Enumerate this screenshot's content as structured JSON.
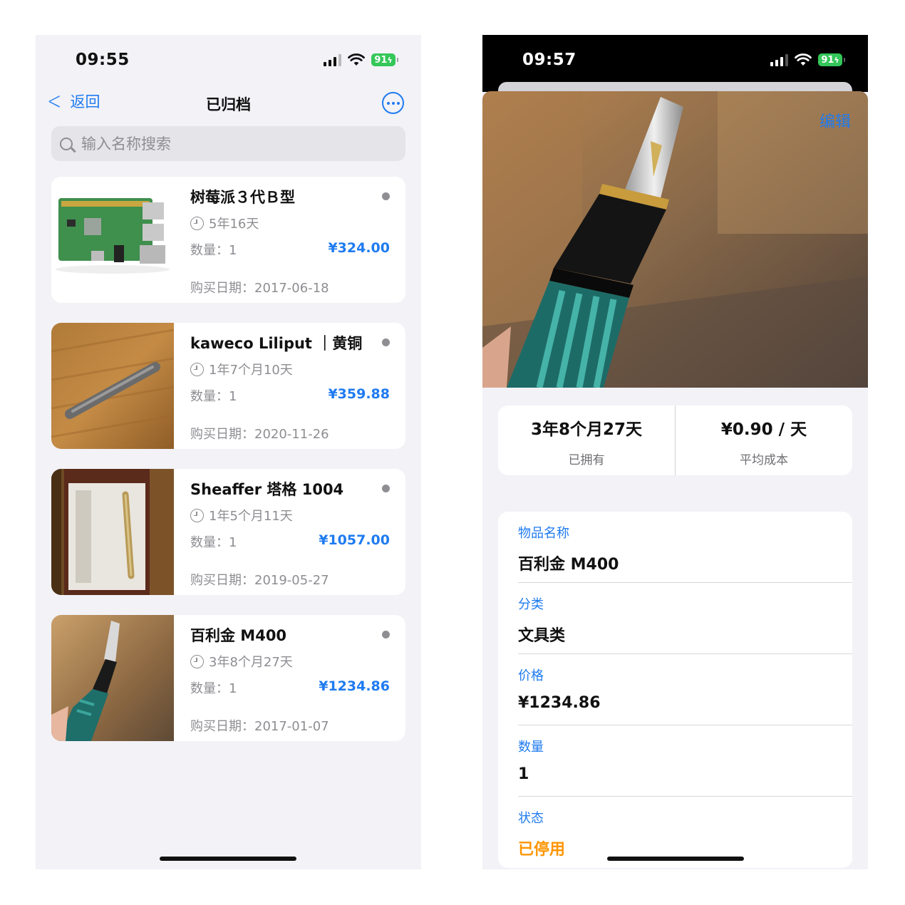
{
  "left": {
    "status": {
      "time": "09:55",
      "battery": "91"
    },
    "nav": {
      "back_label": "返回",
      "title": "已归档"
    },
    "search": {
      "placeholder": "输入名称搜索"
    },
    "items": [
      {
        "name": "树莓派３代Ｂ型",
        "duration": "5年16天",
        "quantity": "数量：1",
        "price": "¥324.00",
        "purchase_date": "购买日期：2017-06-18"
      },
      {
        "name": "kaweco Liliput ｜黄铜",
        "duration": "1年7个月10天",
        "quantity": "数量：1",
        "price": "¥359.88",
        "purchase_date": "购买日期：2020-11-26"
      },
      {
        "name": "Sheaffer 塔格 1004",
        "duration": "1年5个月11天",
        "quantity": "数量：1",
        "price": "¥1057.00",
        "purchase_date": "购买日期：2019-05-27"
      },
      {
        "name": "百利金 M400",
        "duration": "3年8个月27天",
        "quantity": "数量：1",
        "price": "¥1234.86",
        "purchase_date": "购买日期：2017-01-07"
      }
    ]
  },
  "right": {
    "status": {
      "time": "09:57",
      "battery": "91"
    },
    "edit_label": "编辑",
    "stats": {
      "owned_value": "3年8个月27天",
      "owned_label": "已拥有",
      "cost_value": "¥0.90 / 天",
      "cost_label": "平均成本"
    },
    "fields": [
      {
        "label": "物品名称",
        "value": "百利金 M400"
      },
      {
        "label": "分类",
        "value": "文具类"
      },
      {
        "label": "价格",
        "value": "¥1234.86"
      },
      {
        "label": "数量",
        "value": "1"
      },
      {
        "label": "状态",
        "value": "已停用"
      }
    ]
  },
  "colors": {
    "accent": "#1f7bf0",
    "status_inactive": "#ff9500",
    "battery": "#34c759",
    "background": "#f2f2f7"
  }
}
